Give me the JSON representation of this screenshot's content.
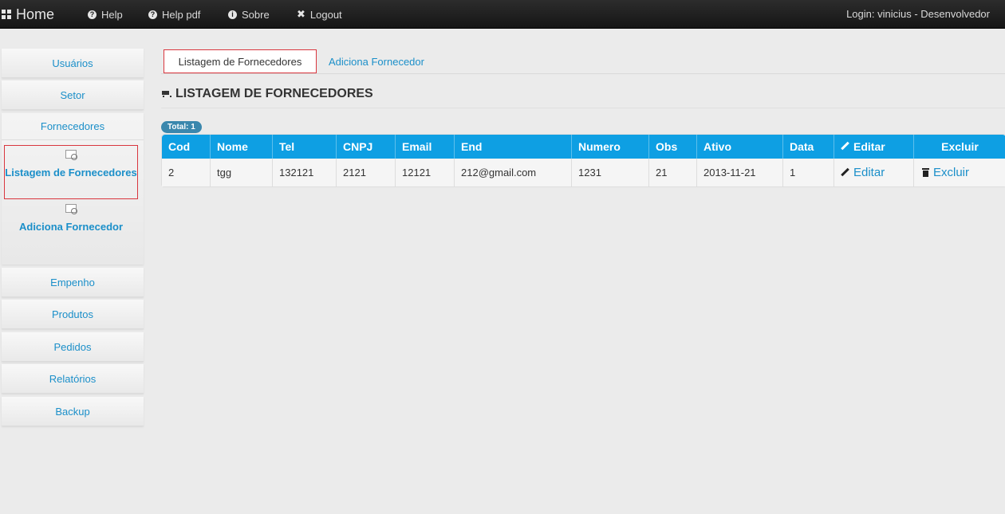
{
  "navbar": {
    "brand": "Home",
    "items": [
      {
        "label": "Help",
        "icon": "help-icon"
      },
      {
        "label": "Help pdf",
        "icon": "help-icon"
      },
      {
        "label": "Sobre",
        "icon": "info-icon"
      },
      {
        "label": "Logout",
        "icon": "close-icon"
      }
    ],
    "login": "Login: vinicius - Desenvolvedor"
  },
  "sidebar": {
    "items_top": [
      {
        "label": "Usuários"
      },
      {
        "label": "Setor"
      }
    ],
    "expanded": {
      "label": "Fornecedores",
      "sub": [
        {
          "label": "Listagem de Fornecedores",
          "active": true
        },
        {
          "label": "Adiciona Fornecedor",
          "active": false
        }
      ]
    },
    "items_bottom": [
      {
        "label": "Empenho"
      },
      {
        "label": "Produtos"
      },
      {
        "label": "Pedidos"
      },
      {
        "label": "Relatórios"
      },
      {
        "label": "Backup"
      }
    ]
  },
  "tabs": [
    {
      "label": "Listagem de Fornecedores",
      "active": true
    },
    {
      "label": "Adiciona Fornecedor",
      "active": false
    }
  ],
  "page_title": "LISTAGEM DE FORNECEDORES",
  "badge": "Total: 1",
  "table": {
    "columns": [
      "Cod",
      "Nome",
      "Tel",
      "CNPJ",
      "Email",
      "End",
      "Numero",
      "Obs",
      "Ativo",
      "Data",
      "Editar",
      "Excluir"
    ],
    "rows": [
      {
        "cells": [
          "2",
          "tgg",
          "132121",
          "2121",
          "12121",
          "212@gmail.com",
          "1231",
          "21",
          "2013-11-21",
          "1"
        ],
        "edit_label": "Editar",
        "delete_label": "Excluir"
      }
    ]
  },
  "colors": {
    "accent": "#1b8fc9",
    "table_header": "#0e9fe3",
    "active_border": "#d9363e",
    "badge": "#3a87ad"
  }
}
